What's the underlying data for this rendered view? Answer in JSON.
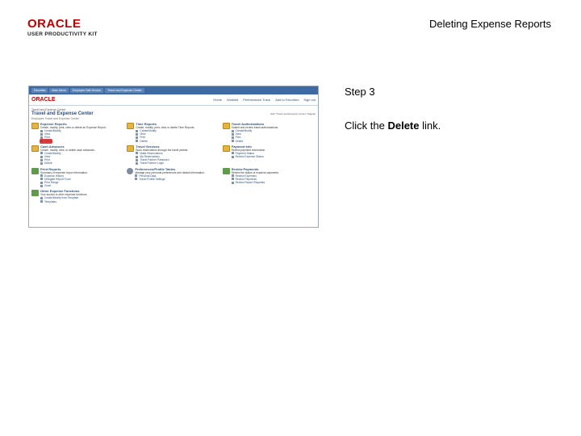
{
  "header": {
    "logo_word": "ORACLE",
    "logo_sub": "USER PRODUCTIVITY KIT",
    "title": "Deleting Expense Reports"
  },
  "thumbnail": {
    "nav": [
      "Favorites",
      "Main Menu",
      "Employee Self-Service",
      "Travel and Expense Center"
    ],
    "brand": "ORACLE",
    "links": [
      "Home",
      "Worklist",
      "Performance Trace",
      "Add to Favorites",
      "Sign out"
    ],
    "breadcrumb": "Travel and Expense Center",
    "page_title": "Travel and Expense Center",
    "personalize": "Edit \"Travel and Expense Center\" Pagelet",
    "subtitle": "Employee Travel and Expense Center",
    "sections": [
      {
        "icon": "folder",
        "heading": "Expense Reports",
        "desc": "Create, modify, print, view or delete an Expense Report.",
        "links": [
          "Create/Modify",
          "View",
          "Print",
          "Delete"
        ],
        "highlight": 3
      },
      {
        "icon": "folder",
        "heading": "Time Reports",
        "desc": "Create, modify, print, view or delete Time Reports.",
        "links": [
          "Create/Modify",
          "View",
          "Print",
          "Delete"
        ],
        "highlight": -1
      },
      {
        "icon": "folder",
        "heading": "Travel Authorizations",
        "desc": "Submit and review travel authorizations.",
        "links": [
          "Create/Modify",
          "View",
          "Print",
          "Delete"
        ],
        "highlight": -1
      },
      {
        "icon": "folder",
        "heading": "Cash Advances",
        "desc": "Create, modify, view, or delete cash advances.",
        "links": [
          "Create/Modify",
          "View",
          "Print",
          "Delete"
        ],
        "highlight": -1
      },
      {
        "icon": "folder",
        "heading": "Travel Services",
        "desc": "Book reservations through the travel partner.",
        "links": [
          "Make Reservations",
          "My Reservations",
          "Travel Partner Password",
          "Travel Partner Login"
        ],
        "highlight": -1
      },
      {
        "icon": "folder",
        "heading": "Payment Info",
        "desc": "Review payment information.",
        "links": [
          "Payment Status",
          "Review Expense Status"
        ],
        "highlight": -1
      },
      {
        "icon": "chart",
        "heading": "Print Reports",
        "desc": "Summary of expense report information.",
        "links": [
          "Expense History",
          "Delegate Report Form",
          "Print Range",
          "Chart"
        ],
        "highlight": -1
      },
      {
        "icon": "gear",
        "heading": "Preferences/Profile Tables",
        "desc": "Manage your personal preferences and default information.",
        "links": [
          "Personal Data",
          "Travel Profile Settings"
        ],
        "highlight": -1
      },
      {
        "icon": "chart",
        "heading": "Review Payments",
        "desc": "Review the status of expense payments.",
        "links": [
          "Review Expenses",
          "Review Payments",
          "Review Report Requests"
        ],
        "highlight": -1
      },
      {
        "icon": "chart",
        "heading": "Other Expense Functions",
        "desc": "Your access to other expense functions.",
        "links": [
          "Create/Modify from Template",
          "Templates"
        ],
        "highlight": -1,
        "span": true
      }
    ]
  },
  "step": {
    "label": "Step 3",
    "instruction_before": "Click the ",
    "instruction_bold": "Delete",
    "instruction_after": " link."
  }
}
